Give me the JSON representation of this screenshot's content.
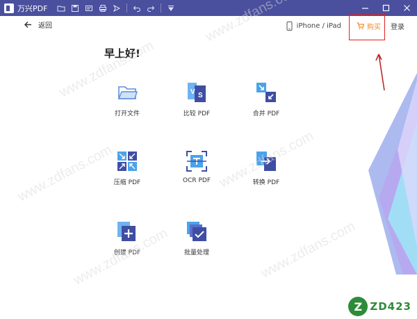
{
  "titlebar": {
    "app_title": "万兴PDF",
    "icons": [
      "folder-icon",
      "save-icon",
      "pdf-icon",
      "print-icon",
      "share-icon",
      "undo-icon",
      "redo-icon",
      "menu-icon"
    ],
    "window_controls": [
      "minimize-icon",
      "maximize-icon",
      "close-icon"
    ],
    "color": "#4a4f9e"
  },
  "header": {
    "back_label": "返回",
    "device_label": "iPhone / iPad",
    "buy_label": "购买",
    "login_label": "登录",
    "buy_color": "#f08a2a",
    "highlight_color": "#e02020"
  },
  "greeting": "早上好!",
  "tools": [
    {
      "label": "打开文件",
      "icon": "open-folder-icon"
    },
    {
      "label": "比较 PDF",
      "icon": "compare-icon"
    },
    {
      "label": "合并 PDF",
      "icon": "merge-icon"
    },
    {
      "label": "压缩 PDF",
      "icon": "compress-icon"
    },
    {
      "label": "OCR PDF",
      "icon": "ocr-icon"
    },
    {
      "label": "转换 PDF",
      "icon": "convert-icon"
    },
    {
      "label": "创建 PDF",
      "icon": "create-icon"
    },
    {
      "label": "批量处理",
      "icon": "batch-icon"
    }
  ],
  "watermark": "www.zdfans.com",
  "brand_logo": {
    "mark": "Z",
    "text": "ZD423"
  }
}
